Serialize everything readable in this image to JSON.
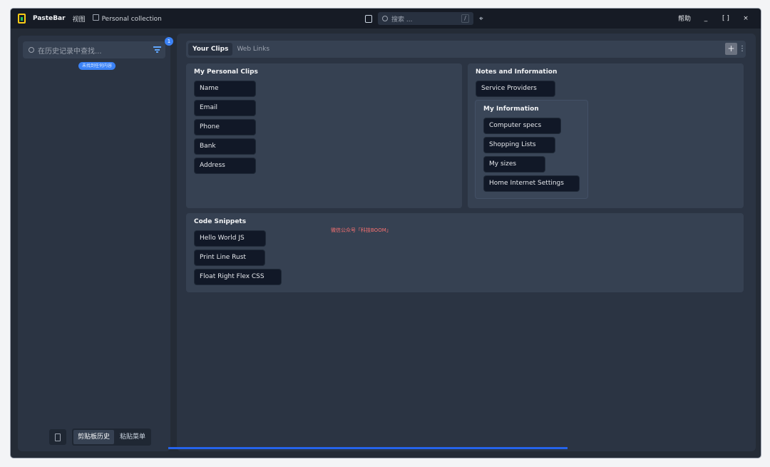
{
  "app": {
    "name": "PasteBar",
    "menu_view": "视图",
    "collection": "Personal collection"
  },
  "topbar": {
    "search_placeholder": "搜索 ...",
    "search_shortcut": "/",
    "help": "帮助",
    "minimize": "_",
    "maximize": "[ ]",
    "close": "×"
  },
  "sidebar": {
    "search_placeholder": "在历史记录中查找...",
    "filter_badge": "1",
    "empty_text": "未找到任何内容",
    "seg_history": "剪贴板历史",
    "seg_menu": "粘贴菜单"
  },
  "tabs": [
    "Your Clips",
    "Web Links"
  ],
  "tab_add": "+",
  "tab_more": "⋮",
  "boards": {
    "personal": {
      "title": "My Personal Clips",
      "clips": [
        "Name",
        "Email",
        "Phone",
        "Bank",
        "Address"
      ]
    },
    "notes": {
      "title": "Notes and Information",
      "clips": [
        "Service Providers"
      ],
      "sub": {
        "title": "My Information",
        "clips": [
          "Computer specs",
          "Shopping Lists",
          "My sizes",
          "Home Internet Settings"
        ]
      }
    },
    "code": {
      "title": "Code Snippets",
      "clips": [
        "Hello World JS",
        "Print Line Rust",
        "Float Right Flex CSS"
      ]
    }
  },
  "watermark": "微信公众号「科技BOOM」"
}
